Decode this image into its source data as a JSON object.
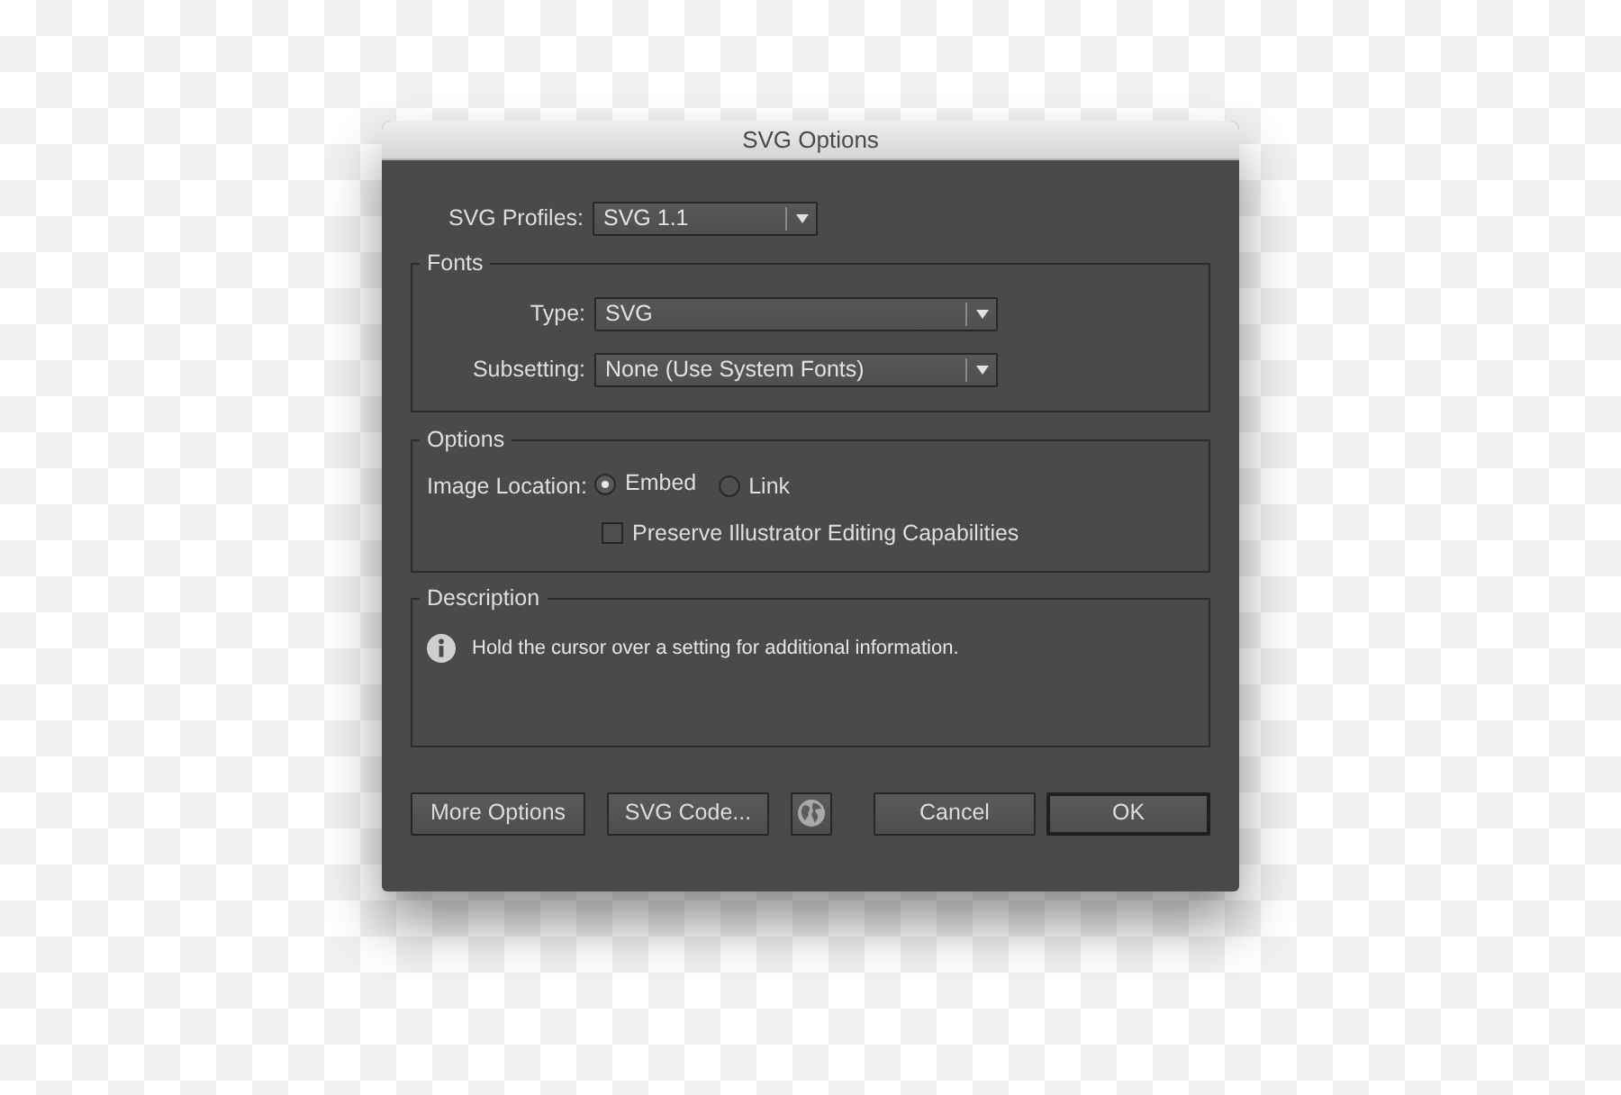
{
  "window": {
    "title": "SVG Options"
  },
  "svg_profiles": {
    "label": "SVG Profiles:",
    "value": "SVG 1.1"
  },
  "fonts": {
    "title": "Fonts",
    "type": {
      "label": "Type:",
      "value": "SVG"
    },
    "subsetting": {
      "label": "Subsetting:",
      "value": "None (Use System Fonts)"
    }
  },
  "options": {
    "title": "Options",
    "image_location": {
      "label": "Image Location:",
      "choices": [
        {
          "label": "Embed",
          "selected": true
        },
        {
          "label": "Link",
          "selected": false
        }
      ]
    },
    "preserve_editing": {
      "label": "Preserve Illustrator Editing Capabilities",
      "checked": false
    }
  },
  "description": {
    "title": "Description",
    "text": "Hold the cursor over a setting for additional information."
  },
  "buttons": [
    {
      "kind": "text",
      "label": "More Options",
      "default": false
    },
    {
      "kind": "text",
      "label": "SVG Code...",
      "default": false
    },
    {
      "kind": "globe",
      "default": false
    },
    {
      "kind": "text",
      "label": "Cancel",
      "default": false
    },
    {
      "kind": "text",
      "label": "OK",
      "default": true
    }
  ]
}
